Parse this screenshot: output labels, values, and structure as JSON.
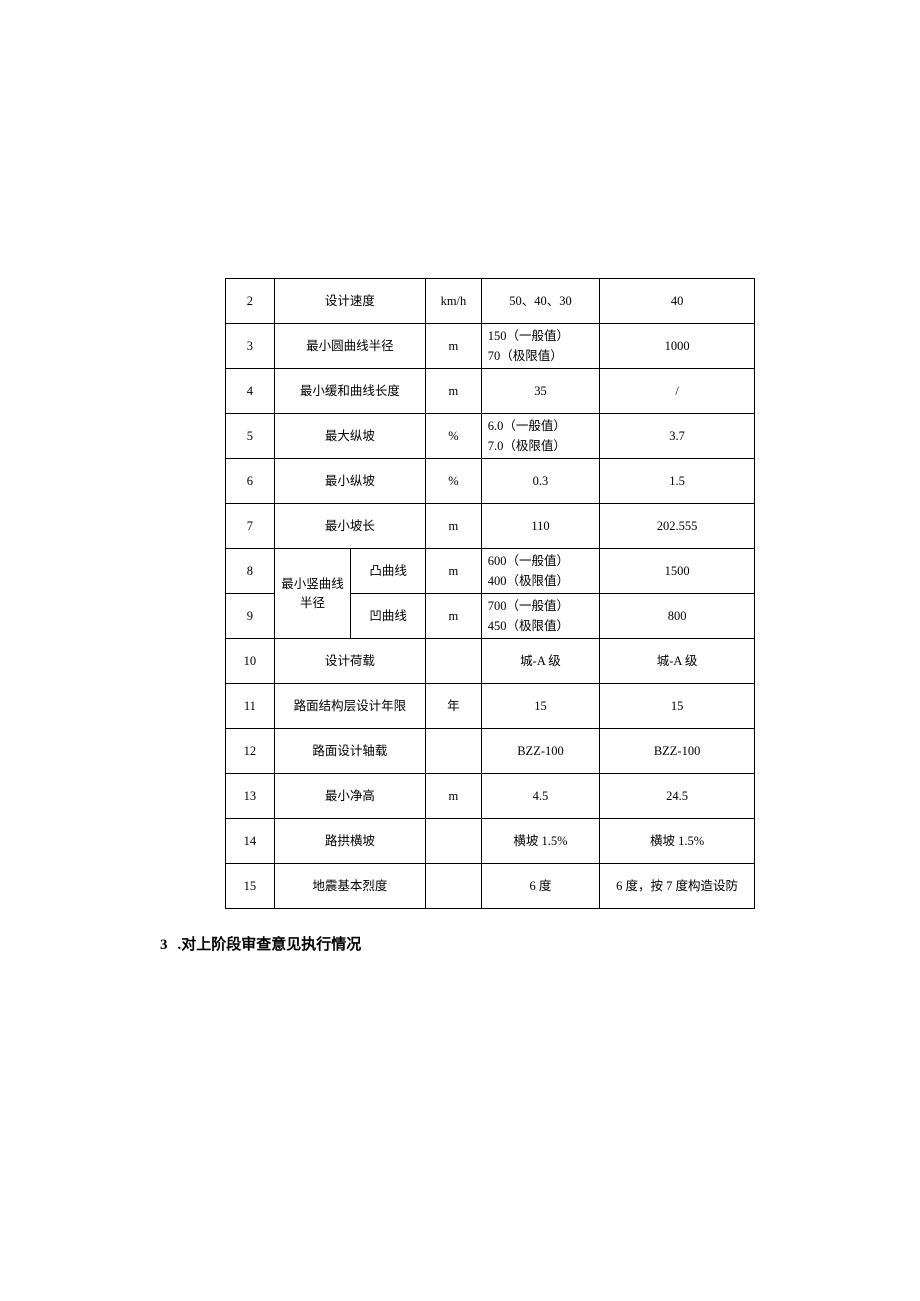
{
  "rows": [
    {
      "n": "2",
      "name": "设计速度",
      "unit": "km/h",
      "spec_plain": "50、40、30",
      "val": "40"
    },
    {
      "n": "3",
      "name": "最小圆曲线半径",
      "unit": "m",
      "spec_lines": [
        "150（一般值）",
        "70（极限值）"
      ],
      "val": "1000"
    },
    {
      "n": "4",
      "name": "最小缓和曲线长度",
      "unit": "m",
      "spec_plain": "35",
      "val": "/"
    },
    {
      "n": "5",
      "name": "最大纵坡",
      "unit": "%",
      "spec_lines": [
        "6.0（一般值）",
        "7.0（极限值）"
      ],
      "val": "3.7"
    },
    {
      "n": "6",
      "name": "最小纵坡",
      "unit": "%",
      "spec_plain": "0.3",
      "val": "1.5"
    },
    {
      "n": "7",
      "name": "最小坡长",
      "unit": "m",
      "spec_plain": "110",
      "val": "202.555"
    },
    {
      "n": "8",
      "unit": "m",
      "spec_lines": [
        "600（一般值）",
        "400（极限值）"
      ],
      "val": "1500",
      "sub": "凸曲线"
    },
    {
      "n": "9",
      "unit": "m",
      "spec_lines": [
        "700（一般值）",
        "450（极限值）"
      ],
      "val": "800",
      "sub": "凹曲线"
    },
    {
      "n": "10",
      "name": "设计荷载",
      "unit": "",
      "spec_plain": "城-A 级",
      "val": "城-A 级"
    },
    {
      "n": "11",
      "name": "路面结构层设计年限",
      "unit": "年",
      "spec_plain": "15",
      "val": "15"
    },
    {
      "n": "12",
      "name": "路面设计轴载",
      "unit": "",
      "spec_plain": "BZZ-100",
      "val": "BZZ-100"
    },
    {
      "n": "13",
      "name": "最小净高",
      "unit": "m",
      "spec_plain": "4.5",
      "val": "24.5"
    },
    {
      "n": "14",
      "name": "路拱横坡",
      "unit": "",
      "spec_plain": "横坡 1.5%",
      "val": "横坡 1.5%"
    },
    {
      "n": "15",
      "name": "地震基本烈度",
      "unit": "",
      "spec_plain": "6 度",
      "val": "6 度，按 7 度构造设防"
    }
  ],
  "merged_name_a": "最小竖曲线",
  "merged_name_b": "半径",
  "heading_num": "3",
  "heading_text": ".对上阶段审查意见执行情况"
}
